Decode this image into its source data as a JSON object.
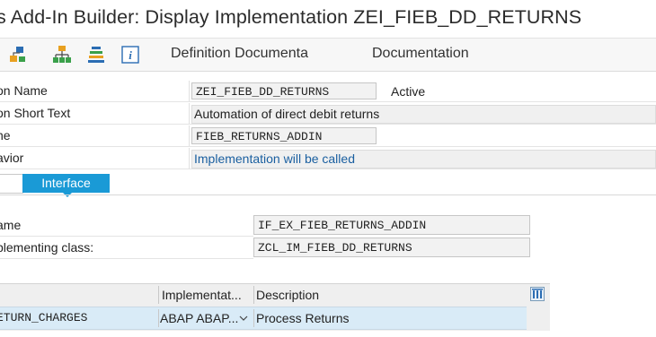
{
  "window": {
    "title": "s Add-In Builder: Display Implementation ZEI_FIEB_DD_RETURNS"
  },
  "toolbar": {
    "icons": [
      "hierarchy-icon",
      "org-structure-icon",
      "stack-icon",
      "info-icon"
    ],
    "definition_doc_label": "Definition Documenta",
    "documentation_label": "Documentation"
  },
  "form": {
    "impl_name_label": "on Name",
    "impl_name_value": "ZEI_FIEB_DD_RETURNS",
    "impl_status": "Active",
    "short_text_label": "on Short Text",
    "short_text_value": "Automation of direct debit returns",
    "badi_name_label": "ne",
    "badi_name_value": "FIEB_RETURNS_ADDIN",
    "behavior_label": "avior",
    "behavior_value": "Implementation will be called",
    "behavior_color": "#1a5fa0"
  },
  "tabs": {
    "active_label": "Interface",
    "accent": "#1a9ad6"
  },
  "interface": {
    "name_label": "ame",
    "name_value": "IF_EX_FIEB_RETURNS_ADDIN",
    "class_label": "plementing class:",
    "class_value": "ZCL_IM_FIEB_DD_RETURNS"
  },
  "table": {
    "columns": [
      "Implementat...",
      "Description"
    ],
    "rows": [
      {
        "method": "ETURN_CHARGES",
        "implementation": "ABAP ABAP...",
        "description": "Process Returns"
      }
    ]
  }
}
